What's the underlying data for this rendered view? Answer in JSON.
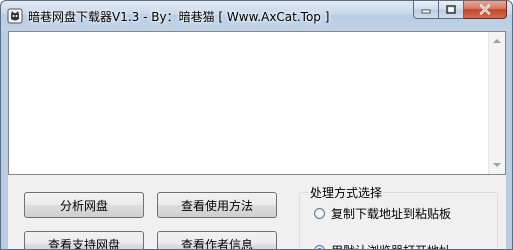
{
  "window": {
    "title": "暗巷网盘下载器V1.3 - By：暗巷猫 [ Www.AxCat.Top ]",
    "app_icon": "cat-logo-icon"
  },
  "caption": {
    "minimize_icon": "minimize-icon",
    "maximize_icon": "maximize-icon",
    "close_icon": "close-icon"
  },
  "log": {
    "text": ""
  },
  "buttons": {
    "analyze": "分析网盘",
    "usage": "查看使用方法",
    "supported": "查看支持网盘",
    "author": "查看作者信息"
  },
  "processing": {
    "group_title": "处理方式选择",
    "options": [
      {
        "label": "复制下载地址到粘贴板",
        "selected": false
      },
      {
        "label": "用默认浏览器打开地址",
        "selected": true
      }
    ]
  }
}
